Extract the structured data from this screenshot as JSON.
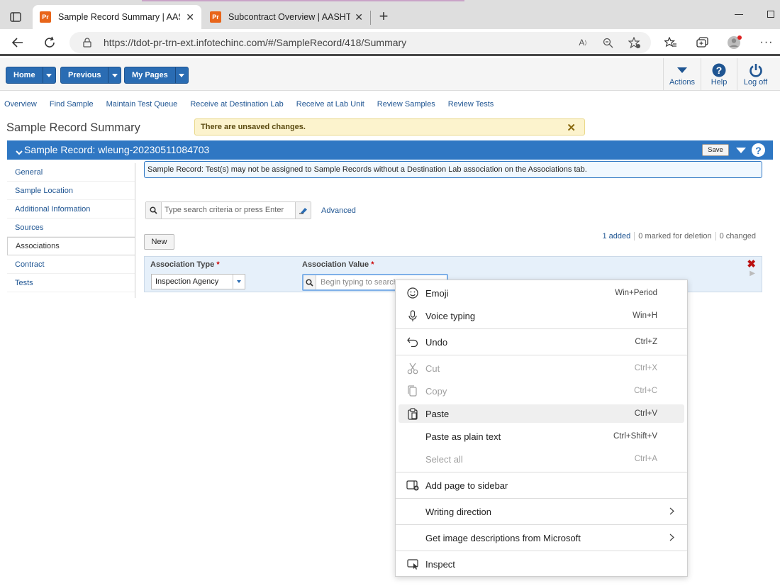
{
  "browser": {
    "tabs": [
      {
        "favicon": "Pr",
        "title": "Sample Record Summary | AASHTO"
      },
      {
        "favicon": "Pr",
        "title": "Subcontract Overview | AASHTOW"
      }
    ],
    "url": "https://tdot-pr-trn-ext.infotechinc.com/#/SampleRecord/418/Summary"
  },
  "appbar": {
    "home": "Home",
    "previous": "Previous",
    "my_pages": "My Pages",
    "actions": "Actions",
    "help": "Help",
    "logoff": "Log off"
  },
  "module_links": [
    "Overview",
    "Find Sample",
    "Maintain Test Queue",
    "Receive at Destination Lab",
    "Receive at Lab Unit",
    "Review Samples",
    "Review Tests"
  ],
  "page": {
    "title": "Sample Record Summary",
    "unsaved": "There are unsaved changes."
  },
  "record": {
    "header": "Sample Record: wleung-20230511084703",
    "save": "Save"
  },
  "sidenav": [
    "General",
    "Sample Location",
    "Additional Information",
    "Sources",
    "Associations",
    "Contract",
    "Tests"
  ],
  "message": "Sample Record: Test(s) may not be assigned to Sample Records without a Destination Lab association on the Associations tab.",
  "search": {
    "placeholder": "Type search criteria or press Enter",
    "advanced": "Advanced"
  },
  "counts": {
    "added": "1 added",
    "marked": "0 marked for deletion",
    "changed": "0 changed"
  },
  "grid": {
    "new_button": "New",
    "col_type": "Association Type",
    "col_value": "Association Value",
    "required_mark": "*",
    "type_value": "Inspection Agency",
    "value_placeholder": "Begin typing to search"
  },
  "context_menu": [
    {
      "label": "Emoji",
      "shortcut": "Win+Period",
      "icon": "emoji-icon"
    },
    {
      "label": "Voice typing",
      "shortcut": "Win+H",
      "icon": "microphone-icon"
    },
    {
      "label": "Undo",
      "shortcut": "Ctrl+Z",
      "icon": "undo-icon"
    },
    {
      "label": "Cut",
      "shortcut": "Ctrl+X",
      "icon": "scissors-icon"
    },
    {
      "label": "Copy",
      "shortcut": "Ctrl+C",
      "icon": "copy-icon"
    },
    {
      "label": "Paste",
      "shortcut": "Ctrl+V",
      "icon": "clipboard-icon"
    },
    {
      "label": "Paste as plain text",
      "shortcut": "Ctrl+Shift+V"
    },
    {
      "label": "Select all",
      "shortcut": "Ctrl+A"
    },
    {
      "label": "Add page to sidebar",
      "icon": "sidebar-add-icon"
    },
    {
      "label": "Writing direction"
    },
    {
      "label": "Get image descriptions from Microsoft"
    },
    {
      "label": "Inspect",
      "icon": "inspect-icon"
    }
  ],
  "colors": {
    "primary": "#2a6cb3",
    "header": "#2f77c3",
    "link": "#1f5592",
    "warning_bg": "#fcf3cd"
  }
}
